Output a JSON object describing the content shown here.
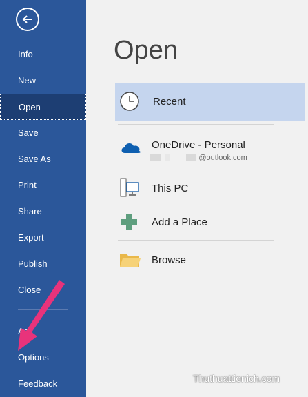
{
  "sidebar": {
    "items": [
      {
        "label": "Info"
      },
      {
        "label": "New"
      },
      {
        "label": "Open"
      },
      {
        "label": "Save"
      },
      {
        "label": "Save As"
      },
      {
        "label": "Print"
      },
      {
        "label": "Share"
      },
      {
        "label": "Export"
      },
      {
        "label": "Publish"
      },
      {
        "label": "Close"
      },
      {
        "label": "Acc"
      },
      {
        "label": "Options"
      },
      {
        "label": "Feedback"
      }
    ],
    "active_item": "Open"
  },
  "main": {
    "title": "Open",
    "locations": [
      {
        "label": "Recent",
        "icon": "clock-icon"
      },
      {
        "label": "OneDrive - Personal",
        "sublabel": "@outlook.com",
        "icon": "cloud-icon"
      },
      {
        "label": "This PC",
        "icon": "computer-icon"
      },
      {
        "label": "Add a Place",
        "icon": "plus-icon"
      },
      {
        "label": "Browse",
        "icon": "folder-icon"
      }
    ]
  },
  "watermark": "Thuthuattienich.com",
  "colors": {
    "sidebar": "#2b579a",
    "active_nav": "#1d3e73",
    "active_location": "#c5d5ee",
    "arrow": "#e8337b"
  }
}
